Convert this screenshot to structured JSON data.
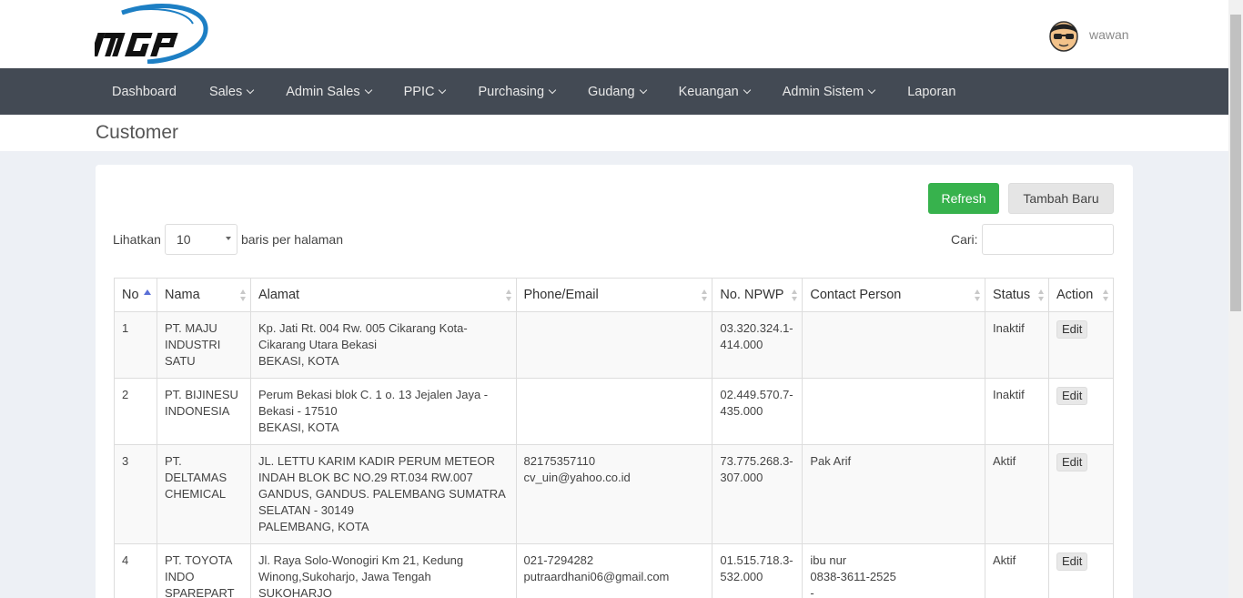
{
  "header": {
    "user_name": "wawan"
  },
  "nav": {
    "items": [
      {
        "label": "Dashboard",
        "dropdown": false
      },
      {
        "label": "Sales",
        "dropdown": true
      },
      {
        "label": "Admin Sales",
        "dropdown": true
      },
      {
        "label": "PPIC",
        "dropdown": true
      },
      {
        "label": "Purchasing",
        "dropdown": true
      },
      {
        "label": "Gudang",
        "dropdown": true
      },
      {
        "label": "Keuangan",
        "dropdown": true
      },
      {
        "label": "Admin Sistem",
        "dropdown": true
      },
      {
        "label": "Laporan",
        "dropdown": false
      }
    ]
  },
  "page": {
    "title": "Customer"
  },
  "toolbar": {
    "refresh_label": "Refresh",
    "add_label": "Tambah Baru"
  },
  "length": {
    "prefix": "Lihatkan",
    "value": "10",
    "suffix": "baris per halaman"
  },
  "search": {
    "label": "Cari:",
    "value": ""
  },
  "table": {
    "columns": [
      "No",
      "Nama",
      "Alamat",
      "Phone/Email",
      "No. NPWP",
      "Contact Person",
      "Status",
      "Action"
    ],
    "rows": [
      {
        "no": "1",
        "nama": "PT. MAJU INDUSTRI SATU",
        "alamat": [
          "Kp. Jati Rt. 004 Rw. 005 Cikarang Kota-Cikarang Utara Bekasi",
          "BEKASI, KOTA"
        ],
        "phone_email": [],
        "npwp": "03.320.324.1-414.000",
        "contact": [],
        "status": "Inaktif",
        "action": "Edit"
      },
      {
        "no": "2",
        "nama": "PT. BIJINESU INDONESIA",
        "alamat": [
          "Perum Bekasi blok C. 1 o. 13 Jejalen Jaya - Bekasi - 17510",
          "BEKASI, KOTA"
        ],
        "phone_email": [],
        "npwp": "02.449.570.7-435.000",
        "contact": [],
        "status": "Inaktif",
        "action": "Edit"
      },
      {
        "no": "3",
        "nama": "PT. DELTAMAS CHEMICAL",
        "alamat": [
          "JL. LETTU KARIM KADIR PERUM METEOR INDAH BLOK BC NO.29 RT.034 RW.007 GANDUS, GANDUS. PALEMBANG SUMATRA SELATAN - 30149",
          "PALEMBANG, KOTA"
        ],
        "phone_email": [
          "82175357110",
          "cv_uin@yahoo.co.id"
        ],
        "npwp": "73.775.268.3-307.000",
        "contact": [
          "Pak Arif"
        ],
        "status": "Aktif",
        "action": "Edit"
      },
      {
        "no": "4",
        "nama": "PT. TOYOTA INDO SPAREPART",
        "alamat": [
          "Jl. Raya Solo-Wonogiri Km 21, Kedung Winong,Sukoharjo, Jawa Tengah",
          "SUKOHARJO"
        ],
        "phone_email": [
          "021-7294282",
          "putraardhani06@gmail.com"
        ],
        "npwp": "01.515.718.3-532.000",
        "contact": [
          "ibu nur",
          "0838-3611-2525",
          "-"
        ],
        "status": "Aktif",
        "action": "Edit"
      }
    ]
  }
}
